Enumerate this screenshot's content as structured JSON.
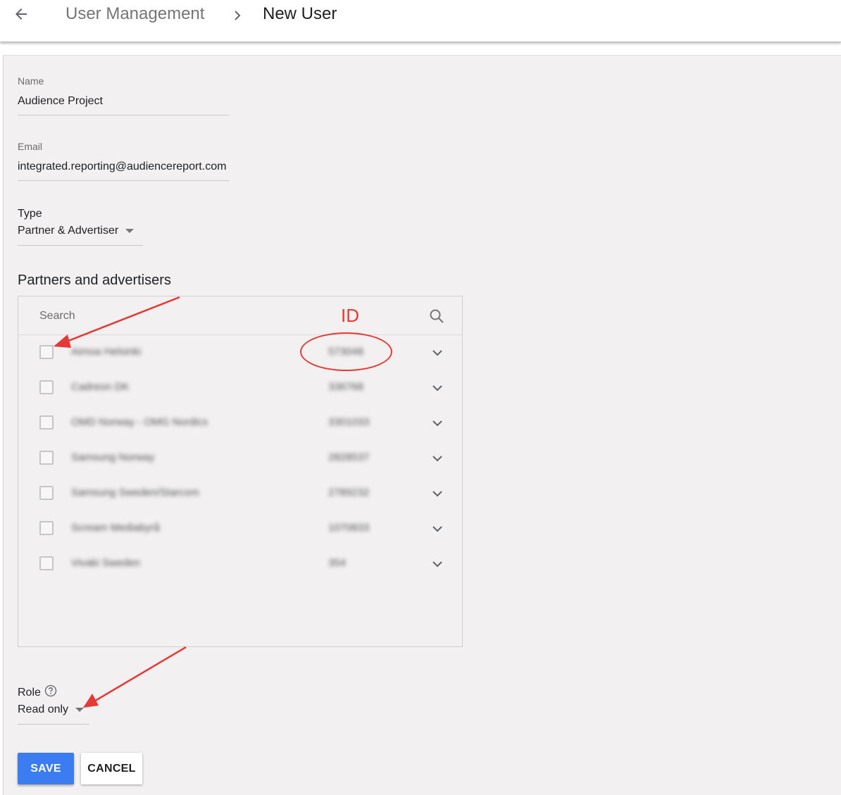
{
  "header": {
    "back_icon": "arrow-left-icon",
    "breadcrumb_parent": "User Management",
    "breadcrumb_separator_icon": "chevron-right-icon",
    "breadcrumb_current": "New User"
  },
  "form": {
    "name": {
      "label": "Name",
      "value": "Audience Project"
    },
    "email": {
      "label": "Email",
      "value": "integrated.reporting@audiencereport.com"
    },
    "type": {
      "label": "Type",
      "value": "Partner & Advertiser"
    },
    "partners": {
      "title": "Partners and advertisers",
      "search_placeholder": "Search",
      "id_annotation": "ID",
      "rows": [
        {
          "name": "Aimoa Helsinki",
          "id": "573048"
        },
        {
          "name": "Cadreon DK",
          "id": "336768"
        },
        {
          "name": "OMD Norway - OMG Nordics",
          "id": "3301033"
        },
        {
          "name": "Samsung Norway",
          "id": "2828537"
        },
        {
          "name": "Samsung Sweden/Starcom",
          "id": "2789232"
        },
        {
          "name": "Scream Mediabyrå",
          "id": "1070833"
        },
        {
          "name": "Vivaki Sweden",
          "id": "354"
        }
      ]
    },
    "role": {
      "label": "Role",
      "value": "Read only",
      "help_icon": "help-circle-icon"
    }
  },
  "actions": {
    "save_label": "SAVE",
    "cancel_label": "CANCEL"
  },
  "colors": {
    "primary": "#3b7cf0",
    "annotation": "#e53935",
    "panel_bg": "#f2f0f1"
  }
}
